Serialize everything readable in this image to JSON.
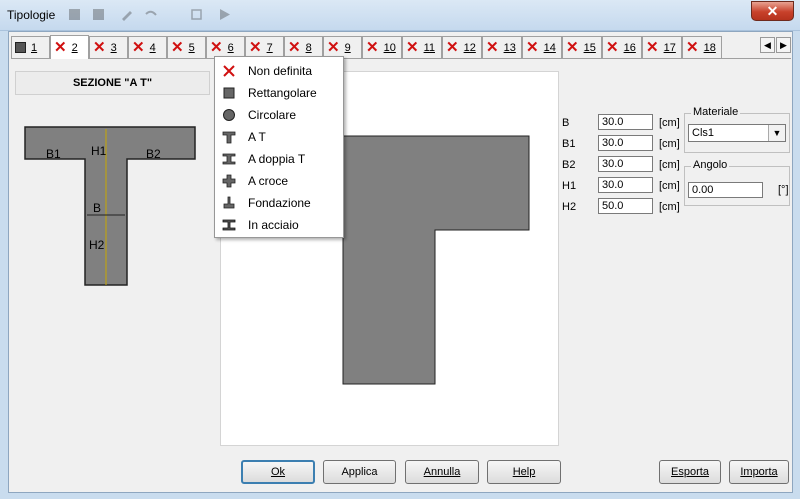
{
  "window": {
    "title": "Tipologie",
    "close_glyph": "✕"
  },
  "tabs": [
    {
      "num": "1",
      "icon": "square"
    },
    {
      "num": "2",
      "icon": "x"
    },
    {
      "num": "3",
      "icon": "x"
    },
    {
      "num": "4",
      "icon": "x"
    },
    {
      "num": "5",
      "icon": "x"
    },
    {
      "num": "6",
      "icon": "x"
    },
    {
      "num": "7",
      "icon": "x"
    },
    {
      "num": "8",
      "icon": "x"
    },
    {
      "num": "9",
      "icon": "x"
    },
    {
      "num": "10",
      "icon": "x"
    },
    {
      "num": "11",
      "icon": "x"
    },
    {
      "num": "12",
      "icon": "x"
    },
    {
      "num": "13",
      "icon": "x"
    },
    {
      "num": "14",
      "icon": "x"
    },
    {
      "num": "15",
      "icon": "x"
    },
    {
      "num": "16",
      "icon": "x"
    },
    {
      "num": "17",
      "icon": "x"
    },
    {
      "num": "18",
      "icon": "x"
    }
  ],
  "section_title": "SEZIONE \"A T\"",
  "thumb_labels": {
    "b1": "B1",
    "b2": "B2",
    "h1": "H1",
    "b": "B",
    "h2": "H2"
  },
  "menu": [
    {
      "label": "Non definita",
      "icon": "x"
    },
    {
      "label": "Rettangolare",
      "icon": "square"
    },
    {
      "label": "Circolare",
      "icon": "circle"
    },
    {
      "label": "A T",
      "icon": "tee"
    },
    {
      "label": "A doppia T",
      "icon": "double-tee"
    },
    {
      "label": "A croce",
      "icon": "cross"
    },
    {
      "label": "Fondazione",
      "icon": "foundation"
    },
    {
      "label": "In acciaio",
      "icon": "steel"
    }
  ],
  "params": [
    {
      "label": "B",
      "value": "30.0",
      "unit": "[cm]"
    },
    {
      "label": "B1",
      "value": "30.0",
      "unit": "[cm]"
    },
    {
      "label": "B2",
      "value": "30.0",
      "unit": "[cm]"
    },
    {
      "label": "H1",
      "value": "30.0",
      "unit": "[cm]"
    },
    {
      "label": "H2",
      "value": "50.0",
      "unit": "[cm]"
    }
  ],
  "materiale": {
    "label": "Materiale",
    "value": "Cls1"
  },
  "angolo": {
    "label": "Angolo",
    "value": "0.00",
    "unit": "[°]"
  },
  "buttons": {
    "ok": "Ok",
    "applica": "Applica",
    "annulla": "Annulla",
    "help": "Help",
    "esporta": "Esporta",
    "importa": "Importa"
  }
}
